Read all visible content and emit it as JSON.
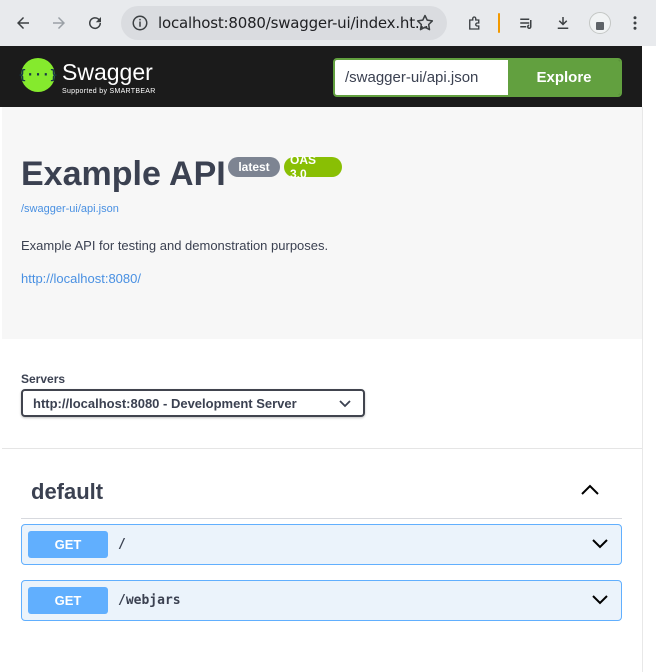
{
  "browser": {
    "url": "localhost:8080/swagger-ui/index.ht...",
    "icons": [
      "back-icon",
      "forward-icon",
      "reload-icon",
      "site-info-icon",
      "bookmark-star-icon",
      "extensions-icon",
      "reading-list-icon",
      "download-icon",
      "profile-avatar",
      "menu-dots-icon"
    ]
  },
  "topbar": {
    "logo_text": "Swagger",
    "logo_sub": "Supported by SMARTBEAR",
    "logo_glyph": "{···}",
    "search_value": "/swagger-ui/api.json",
    "explore_label": "Explore"
  },
  "info": {
    "title": "Example API",
    "version_badge": "latest",
    "oas_badge": "OAS 3.0",
    "spec_link": "/swagger-ui/api.json",
    "description": "Example API for testing and demonstration purposes.",
    "host_link": "http://localhost:8080/"
  },
  "servers": {
    "label": "Servers",
    "selected": "http://localhost:8080 - Development Server"
  },
  "tag": {
    "name": "default"
  },
  "operations": [
    {
      "method": "GET",
      "path": "/"
    },
    {
      "method": "GET",
      "path": "/webjars"
    }
  ],
  "colors": {
    "topbar_bg": "#1b1b1b",
    "explore_green": "#62a03f",
    "get_blue": "#61affe",
    "oas_green": "#89bf04",
    "link_blue": "#4990e2"
  }
}
